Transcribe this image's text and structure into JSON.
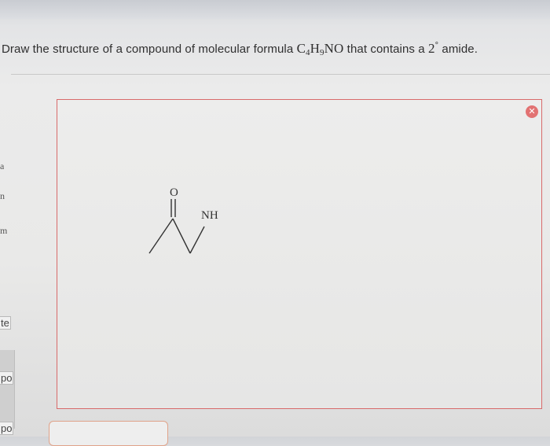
{
  "question": {
    "prefix": "Draw the structure of a compound of molecular formula ",
    "formula_c": "C",
    "formula_c_sub": "4",
    "formula_h": "H",
    "formula_h_sub": "9",
    "formula_rest": "NO",
    "middle": " that contains a ",
    "degree_num": "2",
    "degree_sym": "°",
    "suffix": " amide."
  },
  "rail": {
    "item1": "a",
    "item2": "n",
    "item3": "m",
    "tab1": "te",
    "tab2": "po",
    "tab3": "po"
  },
  "canvas": {
    "atom_o": "O",
    "atom_nh": "NH"
  },
  "colors": {
    "border": "#d86a6a",
    "close_badge": "#e27272",
    "input_border": "#e0a38a"
  },
  "icons": {
    "close": "x-circle-icon"
  }
}
